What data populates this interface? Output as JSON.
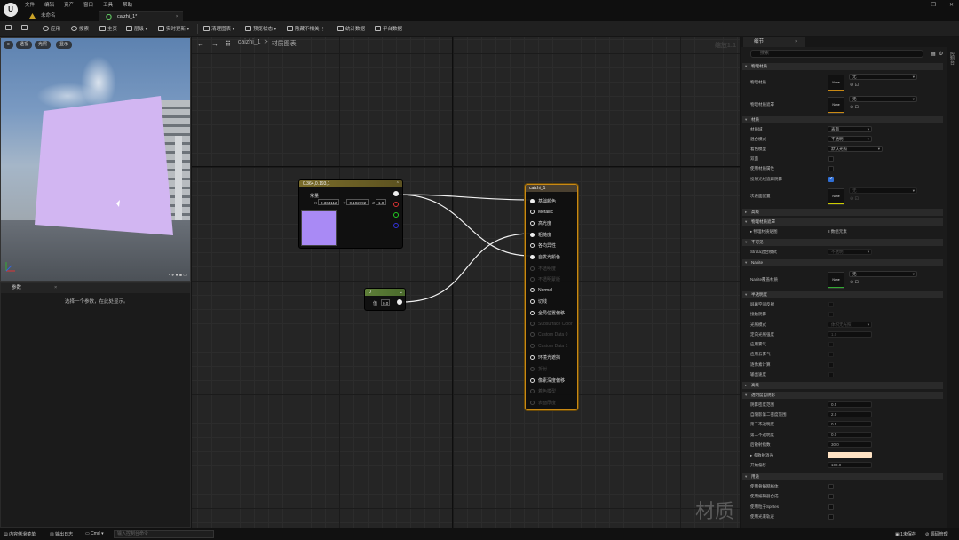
{
  "menu": [
    "文件",
    "编辑",
    "资产",
    "窗口",
    "工具",
    "帮助"
  ],
  "tabs": [
    {
      "label": "未命名"
    },
    {
      "label": "caizhi_1*"
    }
  ],
  "window_controls": {
    "minimize": "–",
    "maximize": "❐",
    "close": "✕"
  },
  "toolbar": {
    "apply": "应用",
    "search": "搜索",
    "home": "主页",
    "hierarchy": "层级",
    "live_update": "实时更新",
    "clean_graph": "清理图表",
    "preview_state": "预览状态",
    "hide_unrelated": "隐藏不相关",
    "stats": "统计数据",
    "platform_stats": "平台数据"
  },
  "viewport": {
    "perspective": "透视",
    "lit": "光照",
    "show": "显示",
    "plane_color": "#d2b6f2"
  },
  "params": {
    "title": "参数",
    "hint": "选择一个参数，在此处显示。"
  },
  "graph": {
    "breadcrumb_root": "caizhi_1",
    "breadcrumb_sep": ">",
    "breadcrumb_current": "材质图表",
    "zoom": "缩放1:1",
    "watermark": "材质",
    "const3": {
      "title": "0.364,0.193,1",
      "label": "常量",
      "x_label": "X",
      "x": "0.364112",
      "y_label": "Y",
      "y": "0.192792",
      "z_label": "Z",
      "z": "1.0",
      "swatch_color": "#a98af5"
    },
    "const1": {
      "title": "0",
      "label": "值",
      "value": "0.0"
    },
    "result": {
      "title": "caizhi_1",
      "pins": [
        {
          "label": "基础颜色",
          "state": "filled"
        },
        {
          "label": "Metallic",
          "state": "hollow"
        },
        {
          "label": "高光度",
          "state": "hollow"
        },
        {
          "label": "粗糙度",
          "state": "filled"
        },
        {
          "label": "各向异性",
          "state": "hollow"
        },
        {
          "label": "自发光颜色",
          "state": "filled"
        },
        {
          "label": "不透明度",
          "state": "disabled"
        },
        {
          "label": "不透明蒙版",
          "state": "disabled"
        },
        {
          "label": "Normal",
          "state": "hollow"
        },
        {
          "label": "切线",
          "state": "hollow"
        },
        {
          "label": "全局位置偏移",
          "state": "hollow"
        },
        {
          "label": "Subsurface Color",
          "state": "disabled"
        },
        {
          "label": "Custom Data 0",
          "state": "disabled"
        },
        {
          "label": "Custom Data 1",
          "state": "disabled"
        },
        {
          "label": "环境光遮挡",
          "state": "hollow"
        },
        {
          "label": "折射",
          "state": "disabled"
        },
        {
          "label": "像素深度偏移",
          "state": "hollow"
        },
        {
          "label": "着色模型",
          "state": "disabled"
        },
        {
          "label": "表面厚度",
          "state": "disabled"
        }
      ]
    }
  },
  "details": {
    "tab_title": "细节",
    "search_placeholder": "搜索",
    "none_thumb": "None",
    "sections": {
      "physical": "物理材质",
      "material": "材质",
      "advanced1": "高级",
      "physical_mask": "物理材质遮罩",
      "translucency_top": "不可见",
      "nanite": "Nanite",
      "translucency": "半透明度",
      "advanced2": "高级",
      "translucent_self_shadow": "透明度自阴影",
      "usage": "用途"
    },
    "rows": {
      "phys_mat": "物理材质",
      "phys_mat_value": "无",
      "phys_mat_mask": "物理材质遮罩",
      "phys_mat_mask_value": "无",
      "material_domain": "材质域",
      "material_domain_value": "表面",
      "blend_mode": "混合模式",
      "blend_mode_value": "不透明",
      "shading_model": "着色模型",
      "shading_model_value": "默认光照",
      "two_sided": "双面",
      "use_material_attributes": "使用材质属性",
      "cast_ray_traced_shadows": "投射光线追踪阴影",
      "subsurface_profile": "次表面配置",
      "subsurface_value": "无",
      "phys_mask_map": "物理材质贴图",
      "phys_mask_map_value": "8 数组元素",
      "strata_blend": "Strata混合模式",
      "strata_blend_value": "不透明",
      "nanite_override": "Nanite覆盖材质",
      "nanite_override_value": "无",
      "screen_space_reflections": "屏幕空间反射",
      "contact_shadows": "接触阴影",
      "lighting_mode": "光照模式",
      "lighting_mode_value": "体积无光照",
      "directional_lighting_intensity": "定向光照强度",
      "directional_lighting_value": "1.0",
      "apply_fogging": "应用雾气",
      "apply_cloud_fogging": "应用云雾气",
      "use_translucency_vertex_fog": "逐像素计算",
      "output_velocity": "输出速度",
      "shadow_density_scale": "阴影密度范围",
      "shadow_density_value": "0.5",
      "self_shadow_second_density": "自阴影第二密度范围",
      "self_shadow_second_value": "2.0",
      "second_opacity": "第二不透明度",
      "second_opacity_value": "0.5",
      "backscatter": "第二不透明度",
      "backscatter_value": "0.0",
      "backscatter_exp": "后散射指数",
      "backscatter_exp_value": "30.0",
      "multiple_scattering": "多散射消光",
      "opacity_offset": "开始偏移",
      "opacity_offset_value": "100.0",
      "used_with_skeletal": "使用骨骼网格体",
      "used_with_editor": "使用编辑器合成",
      "used_with_particle": "使用粒子Sprites",
      "used_with_beam": "使用光束轨迹"
    }
  },
  "statusbar": {
    "content_drawer": "内容侧滑菜单",
    "output_log": "输出日志",
    "cmd": "Cmd",
    "console_placeholder": "输入控制台命令",
    "unsaved": "1未保存",
    "source_control": "源码管理"
  },
  "side_strip": "控制台"
}
